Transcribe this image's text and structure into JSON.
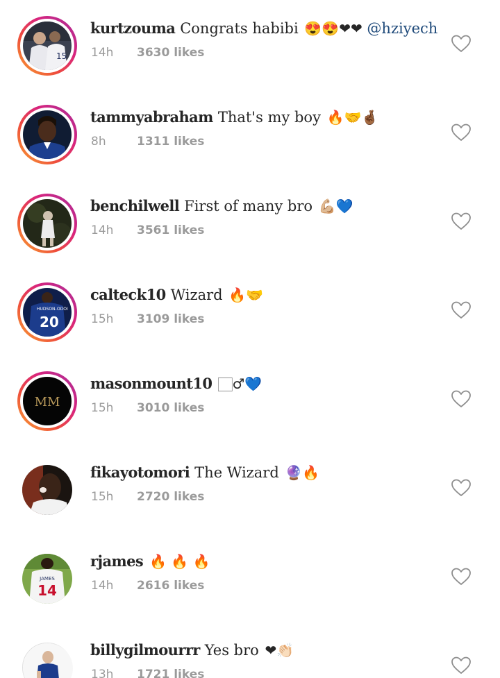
{
  "comments": [
    {
      "username": "kurtzouma",
      "text": "Congrats habibi",
      "emojis": "😍😍❤❤",
      "mention": "@hziyech",
      "time": "14h",
      "likes": "3630 likes",
      "story_ring": true,
      "avatar_colors": [
        "#2f3440",
        "#e8e8ec"
      ]
    },
    {
      "username": "tammyabraham",
      "text": "That's my boy",
      "emojis": "🔥🤝🤞🏾",
      "mention": "",
      "time": "8h",
      "likes": "1311 likes",
      "story_ring": true,
      "avatar_colors": [
        "#13233f",
        "#3a2418"
      ]
    },
    {
      "username": "benchilwell",
      "text": "First of many bro",
      "emojis": "💪🏼💙",
      "mention": "",
      "time": "14h",
      "likes": "3561 likes",
      "story_ring": true,
      "avatar_colors": [
        "#262a1c",
        "#e6e6e6"
      ]
    },
    {
      "username": "calteck10",
      "text": "Wizard",
      "emojis": "🔥🤝",
      "mention": "",
      "time": "15h",
      "likes": "3109 likes",
      "story_ring": true,
      "avatar_colors": [
        "#1c3c8c",
        "#ffffff"
      ]
    },
    {
      "username": "masonmount10",
      "text": "",
      "emojis": "🏻♂💙",
      "mention": "",
      "time": "15h",
      "likes": "3010 likes",
      "story_ring": true,
      "avatar_colors": [
        "#0a0a0a",
        "#b8995a"
      ],
      "avatar_text": "MM"
    },
    {
      "username": "fikayotomori",
      "text": "The Wizard",
      "emojis": "🔮🔥",
      "mention": "",
      "time": "15h",
      "likes": "2720 likes",
      "story_ring": false,
      "avatar_colors": [
        "#1a1410",
        "#d44a2a"
      ]
    },
    {
      "username": "rjames",
      "text": "",
      "emojis": "🔥 🔥 🔥",
      "mention": "",
      "time": "14h",
      "likes": "2616 likes",
      "story_ring": false,
      "avatar_colors": [
        "#7fa84a",
        "#f2f2f2"
      ],
      "avatar_number": "14"
    },
    {
      "username": "billygilmourrr",
      "text": "Yes bro",
      "emojis": "❤👏🏻",
      "mention": "",
      "time": "13h",
      "likes": "1721 likes",
      "story_ring": false,
      "avatar_colors": [
        "#ffffff",
        "#1c3c8c"
      ]
    }
  ],
  "colors": {
    "text": "#262626",
    "meta": "#9a9a9a",
    "mention": "#1f4a7a",
    "heart_outline": "#8e8e8e"
  },
  "icons": {
    "like": "heart-outline-icon"
  }
}
